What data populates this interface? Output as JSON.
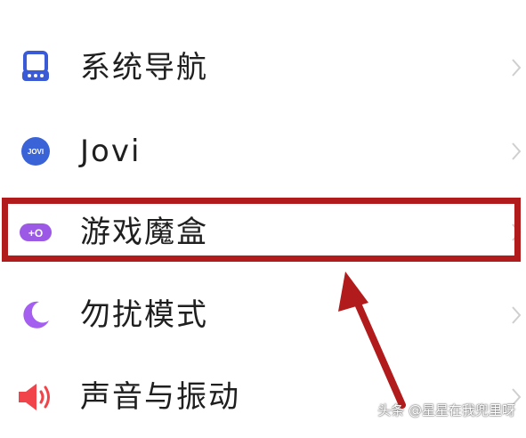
{
  "settings_list": {
    "items": [
      {
        "label": "系统导航",
        "icon": "navigation-icon"
      },
      {
        "label": "Jovi",
        "icon": "jovi-icon",
        "icon_text": "JOVI"
      },
      {
        "label": "游戏魔盒",
        "icon": "gamepad-icon",
        "icon_text": "+O"
      },
      {
        "label": "勿扰模式",
        "icon": "moon-icon"
      },
      {
        "label": "声音与振动",
        "icon": "speaker-icon"
      }
    ]
  },
  "watermark": {
    "text": "头条 @星星在我兜里呀"
  },
  "colors": {
    "highlight": "#b21b1b",
    "nav_icon": "#3b5bd6",
    "jovi_icon": "#3a63d8",
    "game_icon": "#9b59e6",
    "moon_icon": "#a45ef0",
    "speaker_icon": "#f0444a"
  }
}
